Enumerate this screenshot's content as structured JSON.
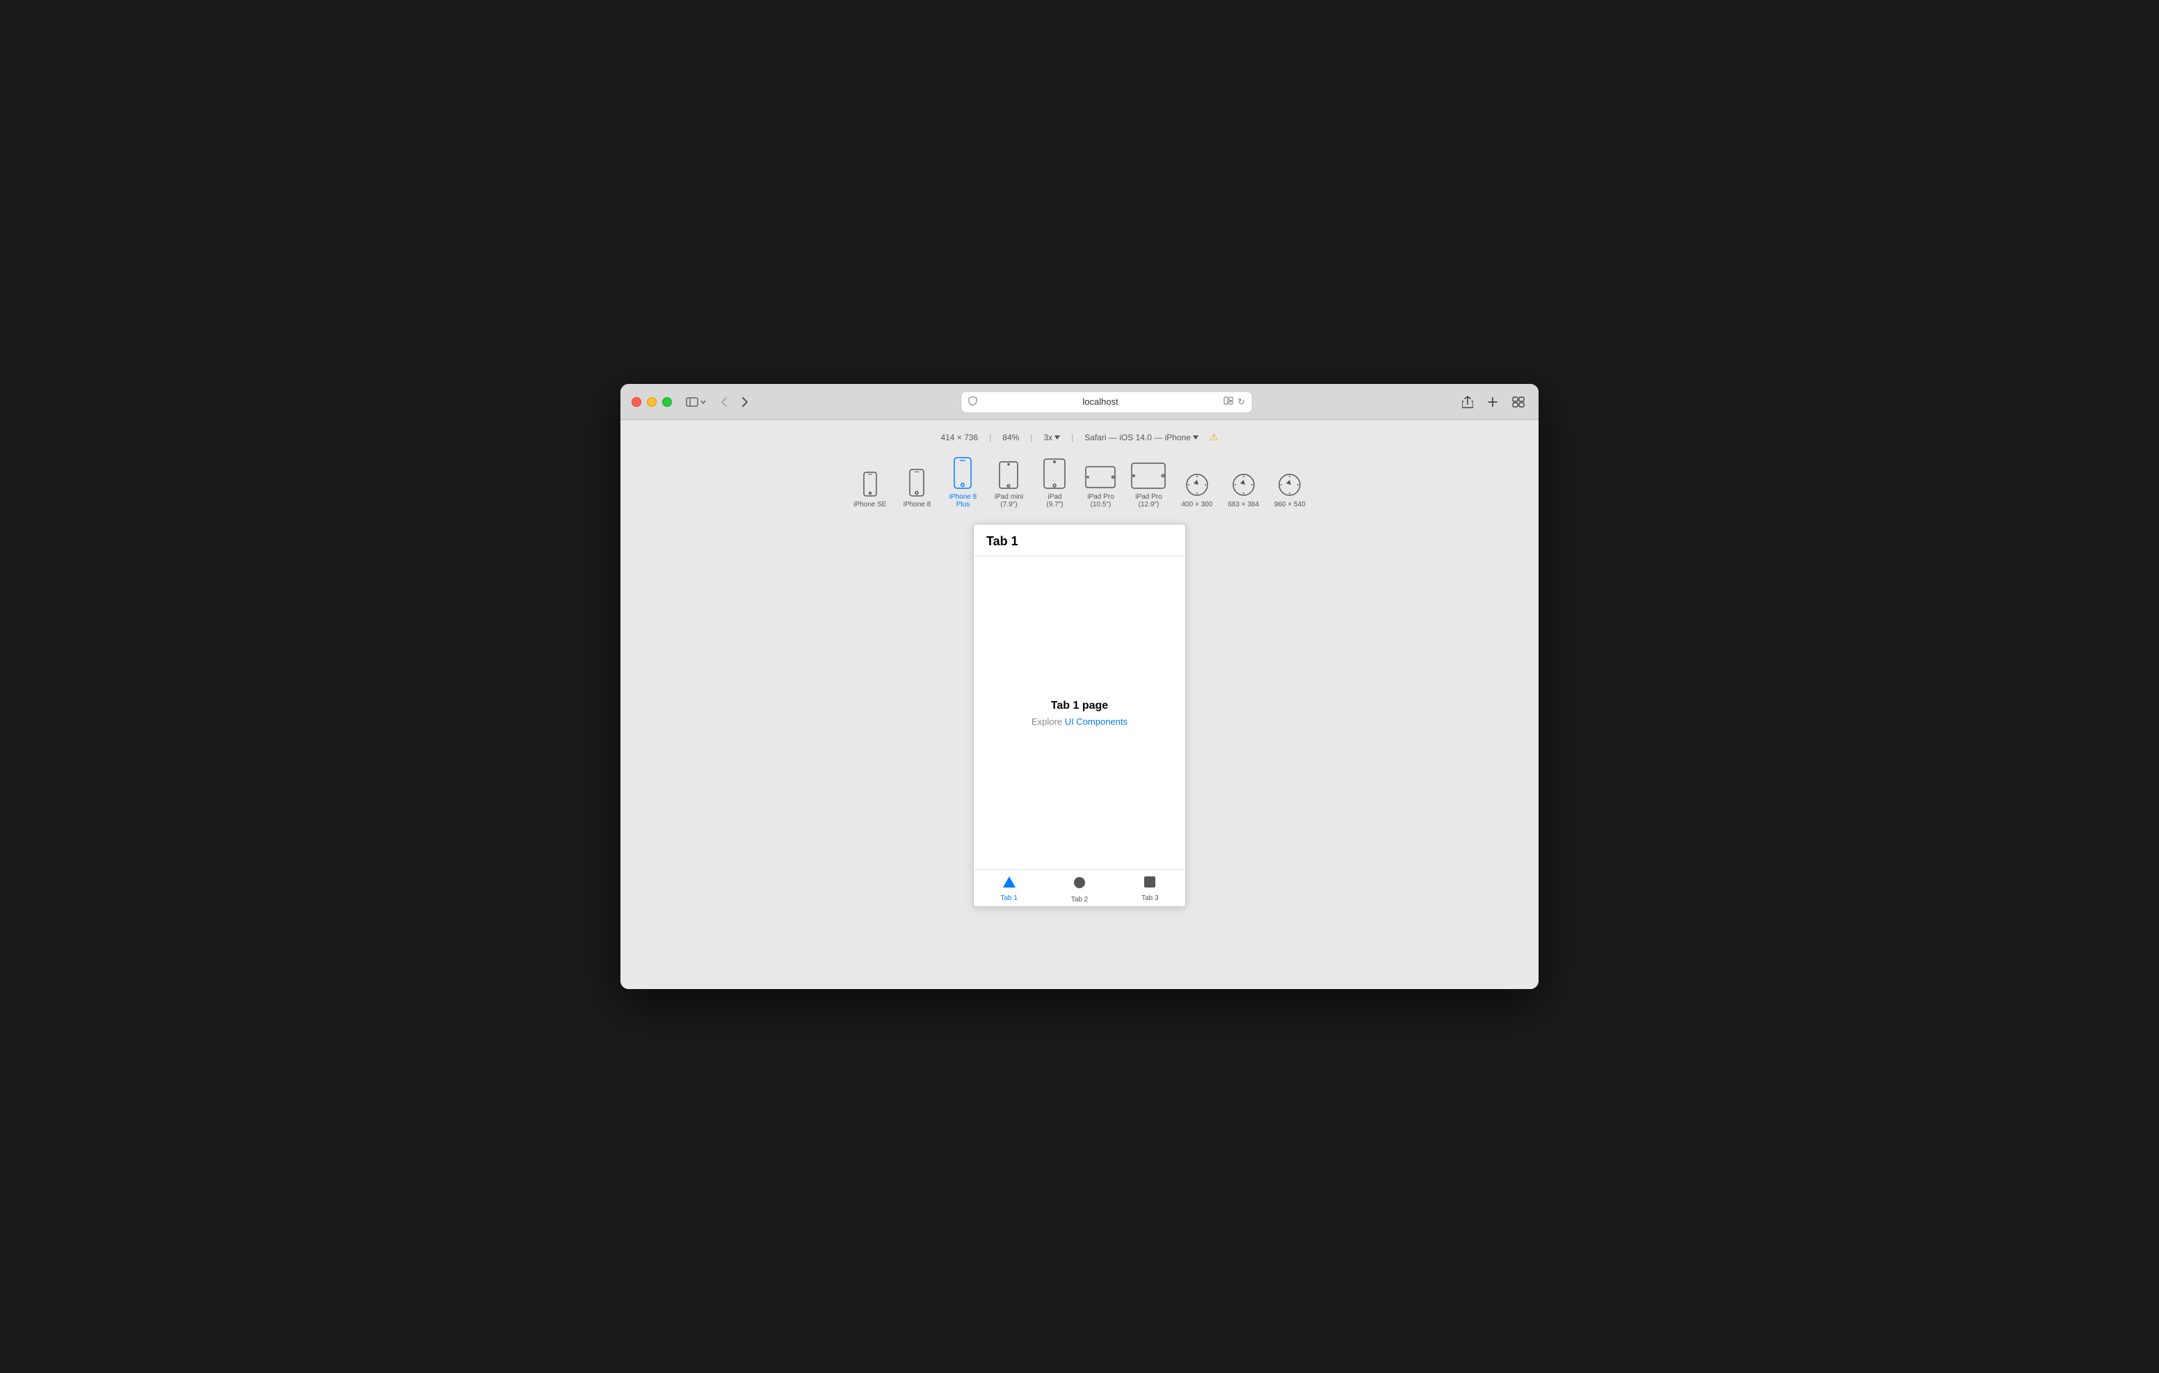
{
  "window": {
    "title": "localhost"
  },
  "traffic_lights": {
    "close_label": "close",
    "minimize_label": "minimize",
    "maximize_label": "maximize"
  },
  "nav": {
    "back_label": "‹",
    "forward_label": "›"
  },
  "address_bar": {
    "url": "localhost",
    "shield_label": "🛡",
    "reader_label": "📖",
    "refresh_label": "↻"
  },
  "toolbar": {
    "share_label": "↑",
    "new_tab_label": "+",
    "grid_label": "⊞"
  },
  "responsive_bar": {
    "dimensions": "414 × 736",
    "zoom": "84%",
    "pixel_ratio": "3x",
    "device_info": "Safari — iOS 14.0 — iPhone",
    "warning_label": "⚠"
  },
  "devices": [
    {
      "id": "iphone-se",
      "label": "iPhone SE",
      "active": false,
      "icon": "phone-small"
    },
    {
      "id": "iphone-8",
      "label": "iPhone 8",
      "active": false,
      "icon": "phone-medium"
    },
    {
      "id": "iphone-8-plus",
      "label": "iPhone 8\nPlus",
      "active": true,
      "icon": "phone-large"
    },
    {
      "id": "ipad-mini",
      "label": "iPad mini\n(7.9″)",
      "active": false,
      "icon": "tablet-small-portrait"
    },
    {
      "id": "ipad",
      "label": "iPad\n(9.7″)",
      "active": false,
      "icon": "tablet-medium-portrait"
    },
    {
      "id": "ipad-pro-105",
      "label": "iPad Pro\n(10.5″)",
      "active": false,
      "icon": "tablet-landscape"
    },
    {
      "id": "ipad-pro-129",
      "label": "iPad Pro\n(12.9″)",
      "active": false,
      "icon": "tablet-large-landscape"
    },
    {
      "id": "custom-400",
      "label": "400 × 300",
      "active": false,
      "icon": "compass"
    },
    {
      "id": "custom-683",
      "label": "683 × 384",
      "active": false,
      "icon": "compass"
    },
    {
      "id": "custom-960",
      "label": "960 × 540",
      "active": false,
      "icon": "compass"
    }
  ],
  "phone_content": {
    "header": "Tab 1",
    "page_title": "Tab 1 page",
    "page_subtitle_prefix": "Explore ",
    "page_link": "UI Components",
    "tabs": [
      {
        "id": "tab1",
        "label": "Tab 1",
        "icon": "triangle",
        "active": true
      },
      {
        "id": "tab2",
        "label": "Tab 2",
        "icon": "circle",
        "active": false
      },
      {
        "id": "tab3",
        "label": "Tab 3",
        "icon": "square",
        "active": false
      }
    ]
  }
}
